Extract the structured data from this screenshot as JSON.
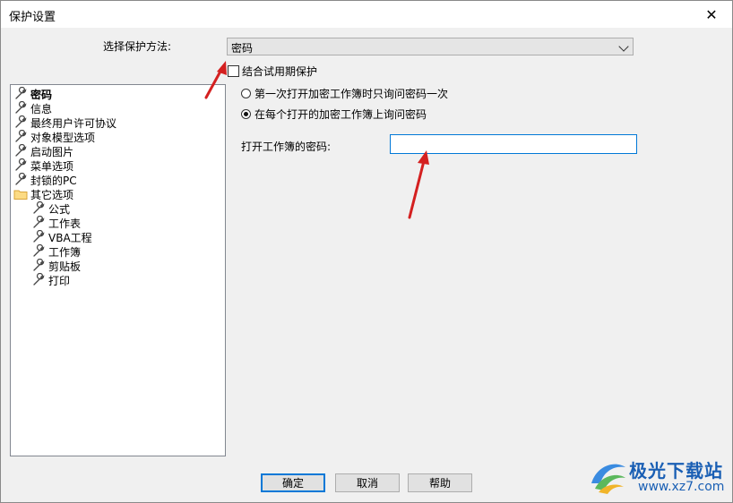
{
  "window": {
    "title": "保护设置",
    "close_glyph": "✕"
  },
  "method": {
    "label": "选择保护方法:",
    "value": "密码"
  },
  "trial": {
    "label": "结合试用期保护",
    "checked": false
  },
  "tree": {
    "items": [
      {
        "label": "密码",
        "icon": "wrench-icon",
        "selected": true
      },
      {
        "label": "信息",
        "icon": "wrench-icon"
      },
      {
        "label": "最终用户许可协议",
        "icon": "wrench-icon"
      },
      {
        "label": "对象模型选项",
        "icon": "wrench-icon"
      },
      {
        "label": "启动图片",
        "icon": "wrench-icon"
      },
      {
        "label": "菜单选项",
        "icon": "wrench-icon"
      },
      {
        "label": "封锁的PC",
        "icon": "wrench-icon"
      },
      {
        "label": "其它选项",
        "icon": "folder-icon"
      },
      {
        "label": "公式",
        "icon": "wrench-icon"
      },
      {
        "label": "工作表",
        "icon": "wrench-icon"
      },
      {
        "label": "VBA工程",
        "icon": "wrench-icon"
      },
      {
        "label": "工作簿",
        "icon": "wrench-icon"
      },
      {
        "label": "剪贴板",
        "icon": "wrench-icon"
      },
      {
        "label": "打印",
        "icon": "wrench-icon"
      }
    ]
  },
  "options": {
    "radio_once": "第一次打开加密工作簿时只询问密码一次",
    "radio_each": "在每个打开的加密工作簿上询问密码",
    "selected": "radio_each"
  },
  "password": {
    "label": "打开工作簿的密码:",
    "value": ""
  },
  "buttons": {
    "ok": "确定",
    "cancel": "取消",
    "help": "帮助"
  },
  "watermark": {
    "name": "极光下载站",
    "url": "www.xz7.com"
  },
  "colors": {
    "accent": "#0078d7",
    "arrow": "#d42020",
    "watermark": "#1a5fb4"
  }
}
